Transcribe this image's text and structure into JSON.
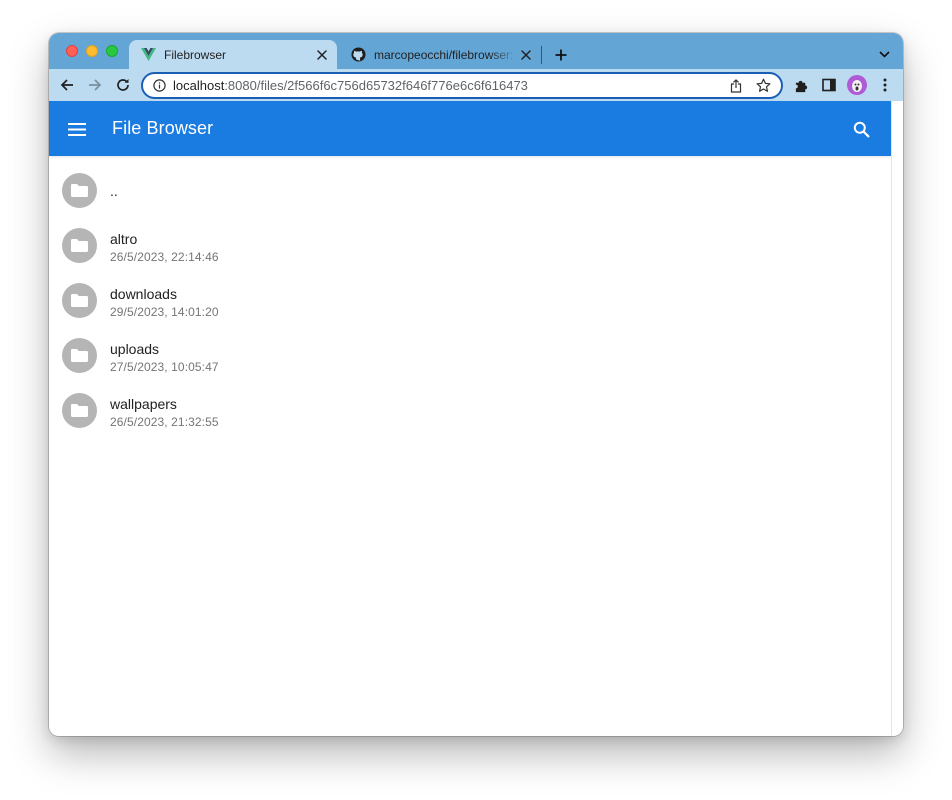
{
  "browser": {
    "tabs": [
      {
        "title": "Filebrowser",
        "active": true,
        "favicon": "vue-icon"
      },
      {
        "title": "marcopeocchi/filebrowser: ligh",
        "active": false,
        "favicon": "github-icon"
      }
    ],
    "address": {
      "host": "localhost",
      "path": ":8080/files/2f566f6c756d65732f646f776e6c6f616473"
    },
    "colors": {
      "tabstrip": "#63a6d6",
      "toolbar": "#bcdbf1",
      "omnibox_focus": "#1a5fb4"
    }
  },
  "app": {
    "title": "File Browser",
    "appbar_color": "#1a7be0",
    "items": [
      {
        "name": "..",
        "date": "",
        "type": "folder"
      },
      {
        "name": "altro",
        "date": "26/5/2023, 22:14:46",
        "type": "folder"
      },
      {
        "name": "downloads",
        "date": "29/5/2023, 14:01:20",
        "type": "folder"
      },
      {
        "name": "uploads",
        "date": "27/5/2023, 10:05:47",
        "type": "folder"
      },
      {
        "name": "wallpapers",
        "date": "26/5/2023, 21:32:55",
        "type": "folder"
      }
    ]
  }
}
